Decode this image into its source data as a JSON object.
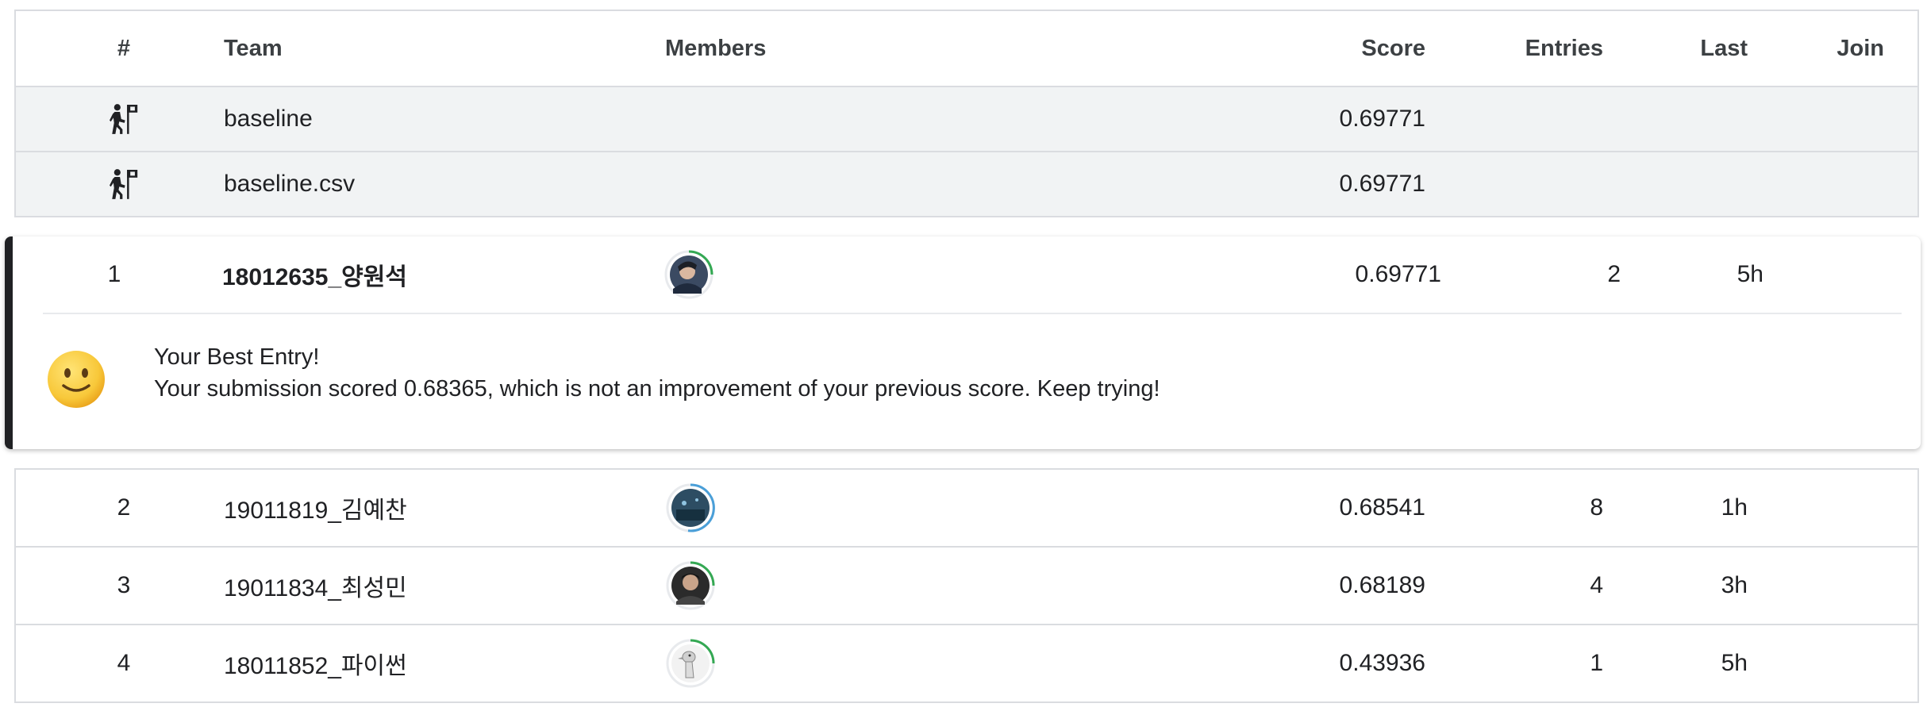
{
  "header": {
    "rank": "#",
    "team": "Team",
    "members": "Members",
    "score": "Score",
    "entries": "Entries",
    "last": "Last",
    "join": "Join"
  },
  "benchmarks": [
    {
      "icon": "benchmark-icon",
      "team": "baseline",
      "score": "0.69771"
    },
    {
      "icon": "benchmark-icon",
      "team": "baseline.csv",
      "score": "0.69771"
    }
  ],
  "my_entry": {
    "rank": "1",
    "team": "18012635_양원석",
    "score": "0.69771",
    "entries": "2",
    "last": "5h",
    "avatar_ring_progress": 0.25,
    "avatar_ring_color": "#34a853",
    "message": {
      "emoji_icon": "slightly-smiling-face-icon",
      "title": "Your Best Entry!",
      "body": "Your submission scored 0.68365, which is not an improvement of your previous score. Keep trying!"
    }
  },
  "rows": [
    {
      "rank": "2",
      "team": "19011819_김예찬",
      "score": "0.68541",
      "entries": "8",
      "last": "1h",
      "ring_color": "#4a9fd8",
      "ring_progress": 0.55
    },
    {
      "rank": "3",
      "team": "19011834_최성민",
      "score": "0.68189",
      "entries": "4",
      "last": "3h",
      "ring_color": "#34a853",
      "ring_progress": 0.25
    },
    {
      "rank": "4",
      "team": "18011852_파이썬",
      "score": "0.43936",
      "entries": "1",
      "last": "5h",
      "ring_color": "#34a853",
      "ring_progress": 0.25
    }
  ]
}
